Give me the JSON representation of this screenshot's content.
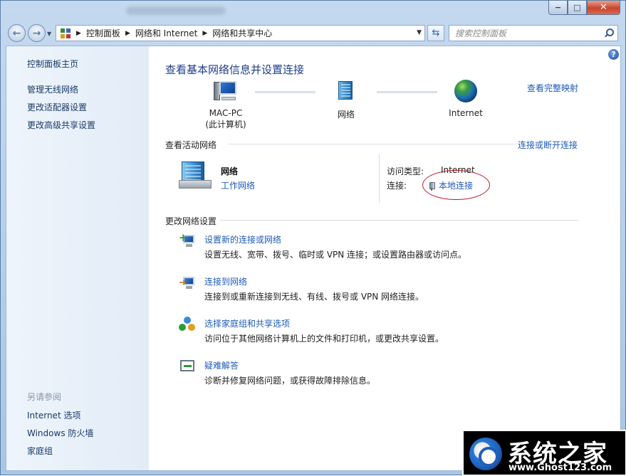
{
  "window": {
    "controls": {
      "minimize": "−",
      "maximize": "□",
      "close": "✕"
    }
  },
  "address_bar": {
    "breadcrumbs": [
      "控制面板",
      "网络和 Internet",
      "网络和共享中心"
    ],
    "search_placeholder": "搜索控制面板"
  },
  "sidebar": {
    "home": "控制面板主页",
    "tasks": [
      "管理无线网络",
      "更改适配器设置",
      "更改高级共享设置"
    ],
    "see_also_heading": "另请参阅",
    "see_also": [
      "Internet 选项",
      "Windows 防火墙",
      "家庭组"
    ]
  },
  "main": {
    "title": "查看基本网络信息并设置连接",
    "full_map_link": "查看完整映射",
    "map": {
      "computer_name": "MAC-PC",
      "computer_sub": "(此计算机)",
      "network": "网络",
      "internet": "Internet"
    },
    "active_networks": {
      "heading": "查看活动网络",
      "connect_link": "连接或断开连接",
      "network_name": "网络",
      "network_type": "工作网络",
      "access_type_label": "访问类型:",
      "access_type_value": "Internet",
      "connections_label": "连接:",
      "connection_name": "本地连接"
    },
    "change_settings": {
      "heading": "更改网络设置",
      "tasks": [
        {
          "title": "设置新的连接或网络",
          "desc": "设置无线、宽带、拨号、临时或 VPN 连接；或设置路由器或访问点。"
        },
        {
          "title": "连接到网络",
          "desc": "连接到或重新连接到无线、有线、拨号或 VPN 网络连接。"
        },
        {
          "title": "选择家庭组和共享选项",
          "desc": "访问位于其他网络计算机上的文件和打印机，或更改共享设置。"
        },
        {
          "title": "疑难解答",
          "desc": "诊断并修复网络问题，或获得故障排除信息。"
        }
      ]
    }
  },
  "watermark": {
    "title": "系统之家",
    "url": "www.Ghost123.com"
  },
  "colors": {
    "link": "#1f5ab8",
    "title": "#1f3d8a",
    "annotation": "#c0182a"
  }
}
